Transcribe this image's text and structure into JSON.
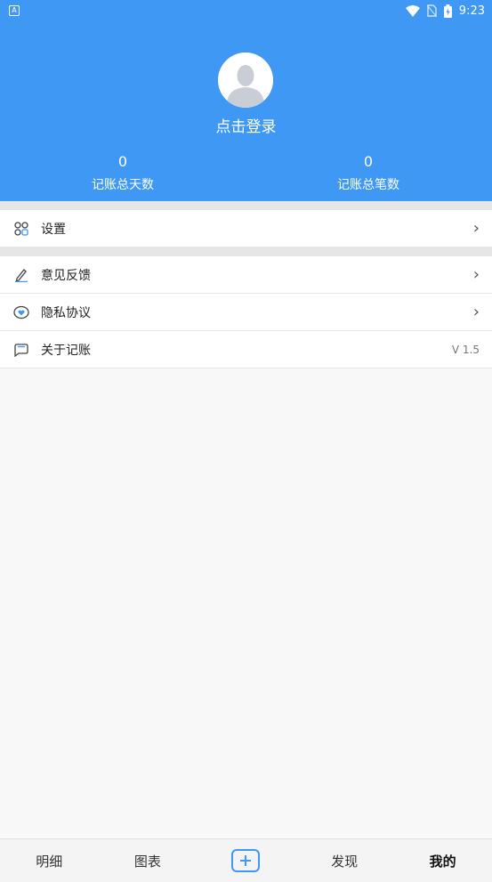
{
  "status_bar": {
    "time": "9:23",
    "notification_icon": "A"
  },
  "header": {
    "login_text": "点击登录",
    "stats": [
      {
        "value": "0",
        "label": "记账总天数"
      },
      {
        "value": "0",
        "label": "记账总笔数"
      }
    ],
    "background_color": "#3f98f4"
  },
  "menu": {
    "settings": {
      "label": "设置",
      "icon": "settings-grid-icon"
    },
    "feedback": {
      "label": "意见反馈",
      "icon": "pencil-icon"
    },
    "privacy": {
      "label": "隐私协议",
      "icon": "heart-shield-icon"
    },
    "about": {
      "label": "关于记账",
      "icon": "chat-bubble-icon",
      "version": "V 1.5"
    }
  },
  "tabbar": {
    "tabs": [
      {
        "label": "明细"
      },
      {
        "label": "图表"
      },
      {
        "label": "发现"
      },
      {
        "label": "我的"
      }
    ],
    "active": "我的",
    "accent": "#3f98f4"
  }
}
